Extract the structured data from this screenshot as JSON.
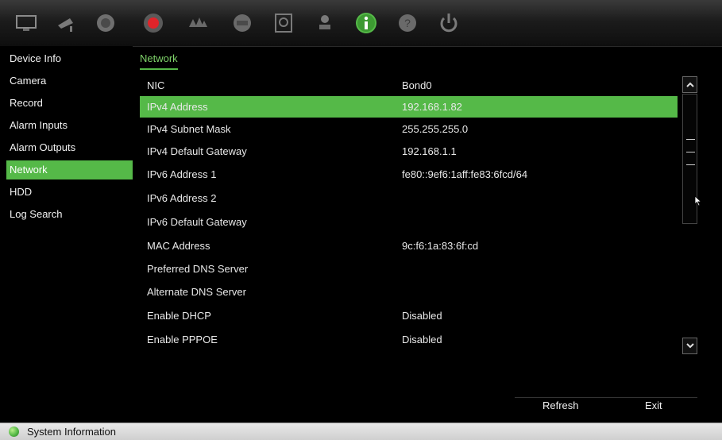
{
  "toolbar": {
    "icons": [
      "monitor-icon",
      "camera-icon",
      "playback-icon",
      "record-icon",
      "alarm-icon",
      "network-icon",
      "hdd-icon",
      "user-icon",
      "system-info-icon",
      "help-icon",
      "power-icon"
    ]
  },
  "sidebar": {
    "items": [
      {
        "label": "Device Info"
      },
      {
        "label": "Camera"
      },
      {
        "label": "Record"
      },
      {
        "label": "Alarm Inputs"
      },
      {
        "label": "Alarm Outputs"
      },
      {
        "label": "Network"
      },
      {
        "label": "HDD"
      },
      {
        "label": "Log Search"
      }
    ],
    "active_index": 5
  },
  "main": {
    "tab": "Network",
    "rows": [
      {
        "label": "NIC",
        "value": "Bond0"
      },
      {
        "label": "IPv4 Address",
        "value": "192.168.1.82"
      },
      {
        "label": "IPv4 Subnet Mask",
        "value": "255.255.255.0"
      },
      {
        "label": "IPv4 Default Gateway",
        "value": "192.168.1.1"
      },
      {
        "label": "IPv6 Address 1",
        "value": "fe80::9ef6:1aff:fe83:6fcd/64"
      },
      {
        "label": "IPv6 Address 2",
        "value": ""
      },
      {
        "label": "IPv6 Default Gateway",
        "value": ""
      },
      {
        "label": "MAC Address",
        "value": "9c:f6:1a:83:6f:cd"
      },
      {
        "label": "Preferred DNS Server",
        "value": ""
      },
      {
        "label": "Alternate DNS Server",
        "value": ""
      },
      {
        "label": "Enable DHCP",
        "value": "Disabled"
      },
      {
        "label": "Enable PPPOE",
        "value": "Disabled"
      }
    ],
    "selected_index": 1
  },
  "buttons": {
    "refresh": "Refresh",
    "exit": "Exit"
  },
  "status": {
    "text": "System Information"
  },
  "colors": {
    "accent": "#55b948",
    "record": "#e0242a"
  }
}
